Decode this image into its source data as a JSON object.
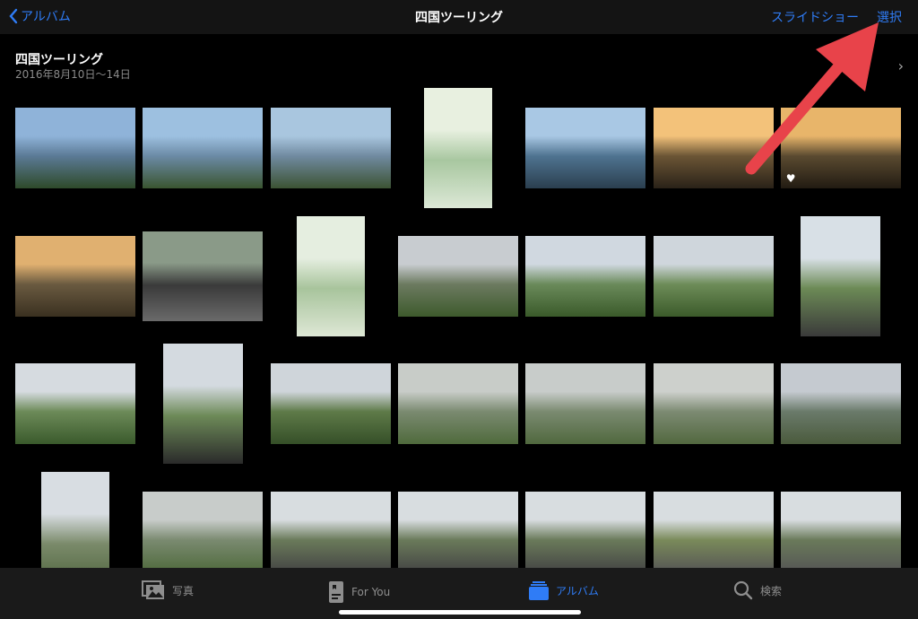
{
  "nav": {
    "back_label": "アルバム",
    "title": "四国ツーリング",
    "slideshow_label": "スライドショー",
    "select_label": "選択"
  },
  "header": {
    "title": "四国ツーリング",
    "date_range": "2016年8月10日〜14日"
  },
  "photos": [
    [
      {
        "kind": "L",
        "colors": [
          "#8fb3d9",
          "#5b7a95",
          "#2e4a2a"
        ]
      },
      {
        "kind": "L",
        "colors": [
          "#9dc0e0",
          "#6b8aa5",
          "#3a5530"
        ]
      },
      {
        "kind": "L",
        "colors": [
          "#a9c6df",
          "#708aa0",
          "#3c5333"
        ]
      },
      {
        "kind": "P",
        "colors": [
          "#e8f0e0",
          "#a8c7a0",
          "#dce8d6"
        ]
      },
      {
        "kind": "L",
        "colors": [
          "#a9c8e4",
          "#4f7390",
          "#2b3f4f"
        ]
      },
      {
        "kind": "L",
        "colors": [
          "#f3c27a",
          "#6b5535",
          "#2a2218"
        ]
      },
      {
        "kind": "L",
        "colors": [
          "#e8b56a",
          "#5a4a30",
          "#221b12"
        ],
        "favorite": true
      }
    ],
    [
      {
        "kind": "L",
        "colors": [
          "#e0b070",
          "#6a5a40",
          "#3a3020"
        ]
      },
      {
        "kind": "M",
        "colors": [
          "#8a9a88",
          "#3a3a3a",
          "#6a6a6a"
        ]
      },
      {
        "kind": "P",
        "colors": [
          "#e5eee0",
          "#a8c49c",
          "#dde7d5"
        ]
      },
      {
        "kind": "L",
        "colors": [
          "#c8ccd0",
          "#6c7a60",
          "#3d5a2c"
        ]
      },
      {
        "kind": "L",
        "colors": [
          "#d0d8e0",
          "#6a8a5a",
          "#3a5a2a"
        ]
      },
      {
        "kind": "L",
        "colors": [
          "#cfd6dc",
          "#6d8c58",
          "#3b5a2a"
        ]
      },
      {
        "kind": "P2",
        "colors": [
          "#d8e0e6",
          "#6c8a56",
          "#3a3a3a"
        ]
      }
    ],
    [
      {
        "kind": "L",
        "colors": [
          "#d6dbe0",
          "#6c8a58",
          "#3a5a2c"
        ]
      },
      {
        "kind": "P2",
        "colors": [
          "#d4dae0",
          "#6d8a58",
          "#2a2a2a"
        ]
      },
      {
        "kind": "L",
        "colors": [
          "#cfd5da",
          "#5e7a48",
          "#354f28"
        ]
      },
      {
        "kind": "L",
        "colors": [
          "#c8ccc8",
          "#7a8a70",
          "#4f6a3c"
        ]
      },
      {
        "kind": "L",
        "colors": [
          "#c8ccca",
          "#7a8a70",
          "#50683e"
        ]
      },
      {
        "kind": "L",
        "colors": [
          "#cdd0cc",
          "#7c8a72",
          "#52683f"
        ]
      },
      {
        "kind": "L",
        "colors": [
          "#c5cad0",
          "#6a7a6a",
          "#4a5a3c"
        ]
      }
    ],
    [
      {
        "kind": "P",
        "colors": [
          "#d8dde2",
          "#7a8a6a",
          "#4a6038"
        ]
      },
      {
        "kind": "L",
        "colors": [
          "#c8ccca",
          "#7a8a70",
          "#4f6a3c"
        ]
      },
      {
        "kind": "L",
        "colors": [
          "#d8dde0",
          "#6a7a5a",
          "#444"
        ]
      },
      {
        "kind": "L",
        "colors": [
          "#d8dde0",
          "#6a7a5a",
          "#444"
        ]
      },
      {
        "kind": "L",
        "colors": [
          "#d8dde0",
          "#6a7a5a",
          "#444"
        ]
      },
      {
        "kind": "L",
        "colors": [
          "#d8dde0",
          "#7a8a5a",
          "#555"
        ]
      },
      {
        "kind": "L",
        "colors": [
          "#d8dde0",
          "#6a7a5a",
          "#555"
        ]
      }
    ]
  ],
  "tabs": [
    {
      "label": "写真",
      "icon": "photos-icon",
      "active": false
    },
    {
      "label": "For You",
      "icon": "for-you-icon",
      "active": false
    },
    {
      "label": "アルバム",
      "icon": "albums-icon",
      "active": true
    },
    {
      "label": "検索",
      "icon": "search-icon",
      "active": false
    }
  ],
  "colors": {
    "accent": "#2f7cf6",
    "annotation_arrow": "#e8434a"
  }
}
